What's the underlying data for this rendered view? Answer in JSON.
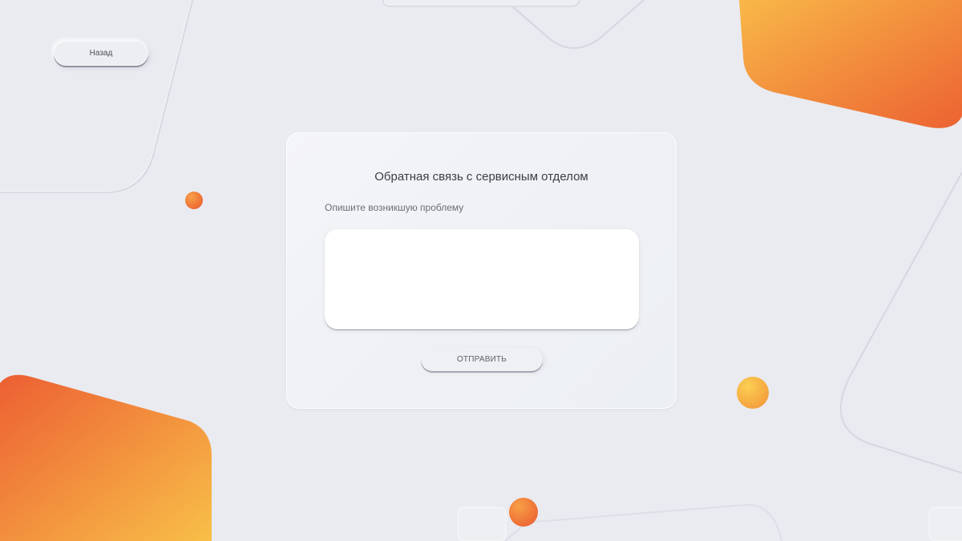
{
  "nav": {
    "back_label": "Назад"
  },
  "feedback": {
    "title": "Обратная связь с сервисным отделом",
    "description_label": "Опишите возникшую проблему",
    "description_value": "",
    "submit_label": "ОТПРАВИТЬ"
  },
  "theme": {
    "background": "#e9ebf0",
    "accent_orange": "#ee6a35",
    "accent_yellow": "#f8be48",
    "card_background": "#f2f3f6",
    "input_background": "#ffffff"
  }
}
